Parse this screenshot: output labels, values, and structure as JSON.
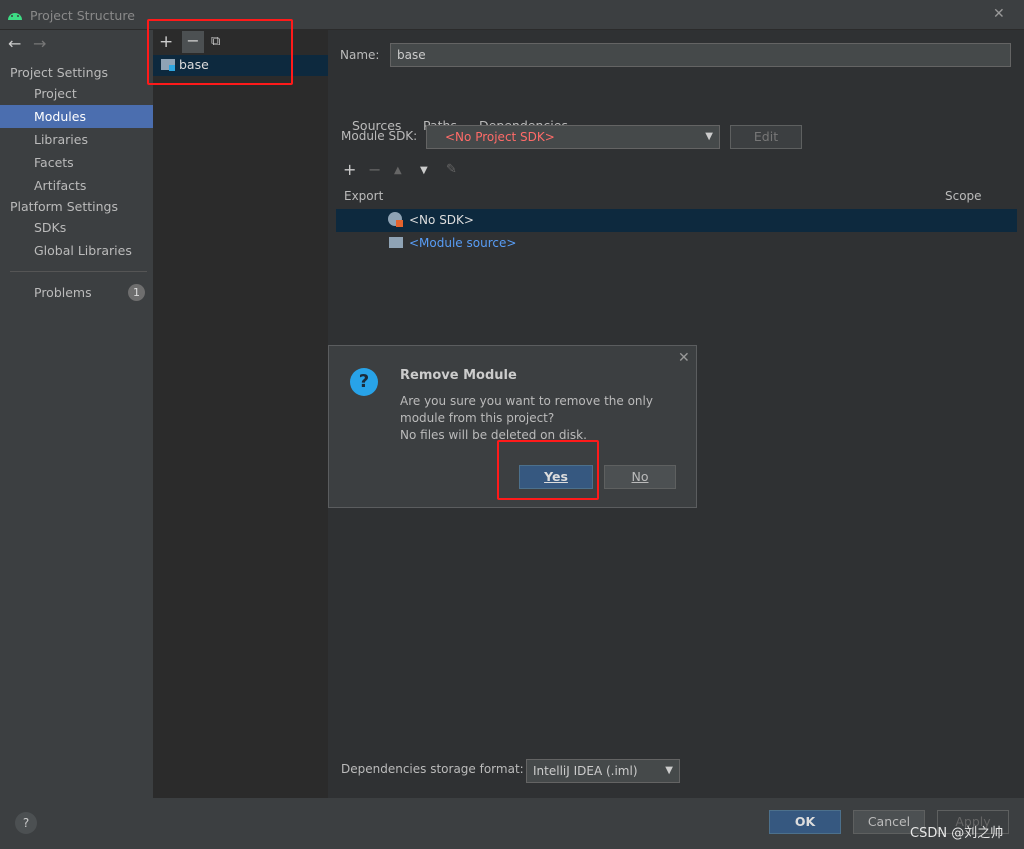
{
  "window": {
    "title": "Project Structure",
    "close": "✕"
  },
  "sidebar": {
    "sections": [
      {
        "label": "Project Settings",
        "items": [
          "Project",
          "Modules",
          "Libraries",
          "Facets",
          "Artifacts"
        ]
      },
      {
        "label": "Platform Settings",
        "items": [
          "SDKs",
          "Global Libraries"
        ]
      }
    ],
    "problems": {
      "label": "Problems",
      "count": "1"
    },
    "selected": "Modules"
  },
  "modules": {
    "items": [
      {
        "name": "base",
        "selected": true
      }
    ]
  },
  "main": {
    "name_label": "Name:",
    "name_value": "base",
    "tabs": [
      "Sources",
      "Paths",
      "Dependencies"
    ],
    "active_tab": "Dependencies",
    "sdk_label": "Module SDK:",
    "sdk_value": "<No Project SDK>",
    "edit_label": "Edit",
    "columns": {
      "export": "Export",
      "scope": "Scope"
    },
    "deps": [
      {
        "name": "<No SDK>",
        "selected": true
      },
      {
        "name": "<Module source>",
        "link": true
      }
    ],
    "storage_label": "Dependencies storage format:",
    "storage_value": "IntelliJ IDEA (.iml)"
  },
  "dialog": {
    "title": "Remove Module",
    "lines": [
      "Are you sure you want to remove the only",
      "module from this project?",
      "No files will be deleted on disk."
    ],
    "yes": "Yes",
    "no": "No"
  },
  "footer": {
    "ok": "OK",
    "cancel": "Cancel",
    "apply": "Apply",
    "help": "?"
  },
  "watermark": "CSDN @刘之帅",
  "colors": {
    "accent": "#4b6eaf",
    "selection": "#0d293e",
    "primary_button": "#365880",
    "error": "#ff6b68",
    "link": "#589df6",
    "highlight_box": "#ff1a1a"
  }
}
